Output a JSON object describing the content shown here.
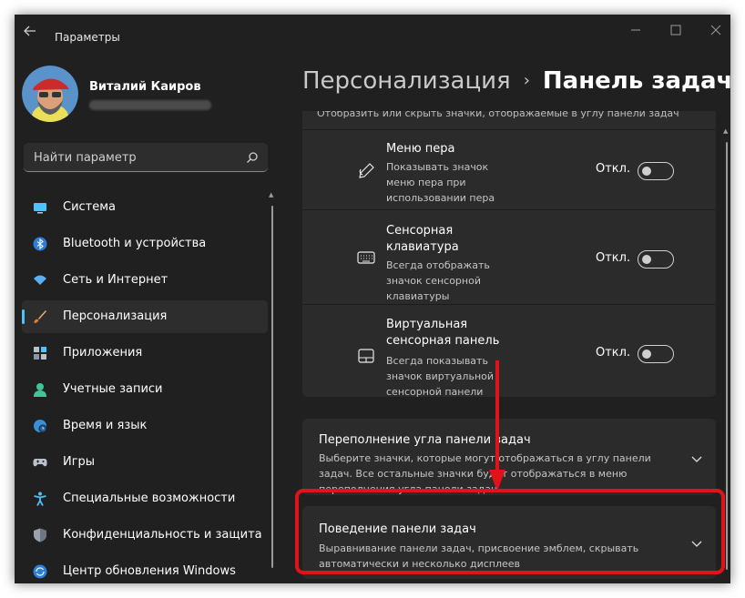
{
  "window": {
    "title": "Параметры"
  },
  "user": {
    "name": "Виталий Каиров"
  },
  "search": {
    "placeholder": "Найти параметр"
  },
  "nav": {
    "items": [
      {
        "label": "Система",
        "icon": "monitor-icon"
      },
      {
        "label": "Bluetooth и устройства",
        "icon": "bluetooth-icon"
      },
      {
        "label": "Сеть и Интернет",
        "icon": "wifi-icon"
      },
      {
        "label": "Персонализация",
        "icon": "brush-icon",
        "active": true
      },
      {
        "label": "Приложения",
        "icon": "apps-icon"
      },
      {
        "label": "Учетные записи",
        "icon": "user-icon"
      },
      {
        "label": "Время и язык",
        "icon": "globe-clock-icon"
      },
      {
        "label": "Игры",
        "icon": "gamepad-icon"
      },
      {
        "label": "Специальные возможности",
        "icon": "accessibility-icon"
      },
      {
        "label": "Конфиденциальность и защита",
        "icon": "shield-icon"
      },
      {
        "label": "Центр обновления Windows",
        "icon": "update-icon"
      }
    ]
  },
  "breadcrumb": {
    "parent": "Персонализация",
    "separator": "›",
    "current": "Панель задач"
  },
  "section": {
    "cut_text": "Отобразить или скрыть значки, отображаемые в углу панели задач"
  },
  "rows": [
    {
      "title": "Меню пера",
      "desc": "Показывать значок меню пера при использовании пера",
      "state": "Откл.",
      "icon": "pen-icon"
    },
    {
      "title": "Сенсорная клавиатура",
      "desc": "Всегда отображать значок сенсорной клавиатуры",
      "state": "Откл.",
      "icon": "keyboard-icon"
    },
    {
      "title": "Виртуальная сенсорная панель",
      "desc": "Всегда показывать значок виртуальной сенсорной панели",
      "state": "Откл.",
      "icon": "touchpad-icon"
    }
  ],
  "cards": [
    {
      "title": "Переполнение угла панели задач",
      "desc": "Выберите значки, которые могут отображаться в углу панели задач. Все остальные значки будут отображаться в меню переполнения угла панели задач"
    },
    {
      "title": "Поведение панели задач",
      "desc": "Выравнивание панели задач, присвоение эмблем, скрывать автоматически и несколько дисплеев"
    }
  ],
  "colors": {
    "background": "#202020",
    "card": "#2b2b2b",
    "accent": "#4cc2ff",
    "annotation": "#e0121a"
  }
}
